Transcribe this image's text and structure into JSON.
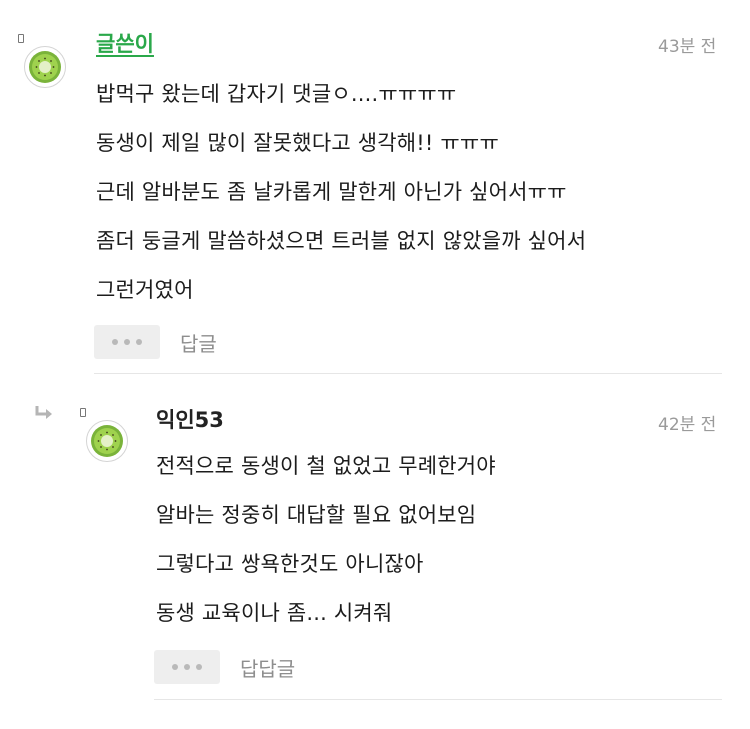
{
  "comments": [
    {
      "author": "글쓴이",
      "time": "43분 전",
      "lines": [
        "밥먹구 왔는데 갑자기 댓글ㅇ....ㅠㅠㅠㅠ",
        "동생이 제일 많이 잘못했다고 생각해!! ㅠㅠㅠ",
        "근데 알바분도 좀 날카롭게 말한게 아닌가 싶어서ㅠㅠ",
        "좀더 둥글게 말씀하셨으면 트러블 없지 않았을까 싶어서",
        "그런거였어"
      ],
      "reply_label": "답글"
    },
    {
      "author": "익인53",
      "time": "42분 전",
      "lines": [
        "전적으로 동생이 철 없었고 무례한거야",
        "알바는 정중히 대답할 필요 없어보임",
        "그렇다고 쌍욕한것도 아니잖아",
        "동생 교육이나 좀... 시켜줘"
      ],
      "reply_label": "답답글"
    }
  ],
  "icons": {
    "avatar": "kiwi-icon",
    "more": "more-dots-icon",
    "reply": "reply-arrow-icon",
    "pin": "pin-icon"
  },
  "colors": {
    "writer_name": "#2aa84a",
    "kiwi_flesh": "#8cc63f",
    "kiwi_core": "#e4f0c8",
    "timestamp": "#9a9a9a"
  }
}
